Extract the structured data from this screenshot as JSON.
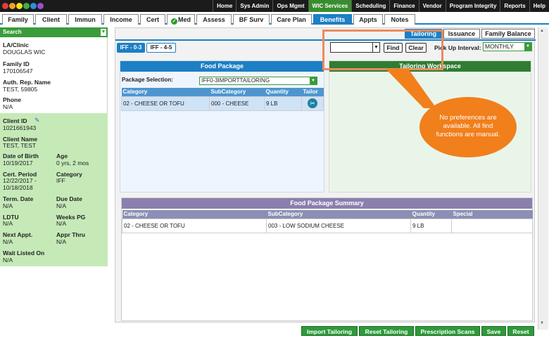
{
  "topnav": [
    "Home",
    "Sys Admin",
    "Ops Mgmt",
    "WIC Services",
    "Scheduling",
    "Finance",
    "Vendor",
    "Program Integrity",
    "Reports",
    "Help"
  ],
  "topnav_active": "WIC Services",
  "tabs": [
    "Family",
    "Client",
    "Immun",
    "Income",
    "Cert",
    "Med",
    "Assess",
    "BF Surv",
    "Care Plan",
    "Benefits",
    "Appts",
    "Notes"
  ],
  "tabs_active": "Benefits",
  "sidebar": {
    "search": "Search",
    "la_clinic_label": "LA/Clinic",
    "la_clinic": "DOUGLAS WIC",
    "family_id_label": "Family ID",
    "family_id": "170106547",
    "auth_rep_label": "Auth. Rep. Name",
    "auth_rep": "TEST, 59805",
    "phone_label": "Phone",
    "phone": "N/A",
    "client_id_label": "Client ID",
    "client_id": "1021661943",
    "client_name_label": "Client Name",
    "client_name": "TEST, TEST",
    "dob_label": "Date of Birth",
    "dob": "10/19/2017",
    "age_label": "Age",
    "age": "0 yrs, 2 mos",
    "cert_period_label": "Cert. Period",
    "cert_period_1": "12/22/2017 -",
    "cert_period_2": "10/18/2018",
    "category_label": "Category",
    "category": "IFF",
    "term_date_label": "Term. Date",
    "term_date": "N/A",
    "due_date_label": "Due Date",
    "due_date": "N/A",
    "ldtu_label": "LDTU",
    "ldtu": "N/A",
    "weeks_pg_label": "Weeks PG",
    "weeks_pg": "N/A",
    "next_appt_label": "Next Appt.",
    "next_appt": "N/A",
    "appr_thru_label": "Appr Thru",
    "appr_thru": "N/A",
    "wait_listed_label": "Wait Listed On",
    "wait_listed": "N/A"
  },
  "subtabs": {
    "tailoring": "Tailoring",
    "issuance": "Issuance",
    "family_balance": "Family Balance"
  },
  "age_tabs": {
    "a": "IFF - 0-3",
    "b": "IFF - 4-5"
  },
  "find_label": "Find",
  "clear_label": "Clear",
  "pickup_label": "Pick Up Interval:",
  "pickup_value": "MONTHLY",
  "food_package": {
    "title": "Food Package",
    "selection_label": "Package Selection:",
    "selection_value": "IFF0-3IMPORTTAILORING",
    "headers": [
      "Category",
      "SubCategory",
      "Quantity",
      "Tailor"
    ],
    "rows": [
      {
        "category": "02 - CHEESE OR TOFU",
        "subcategory": "000 - CHEESE",
        "quantity": "9 LB"
      }
    ]
  },
  "tailoring_workspace": "Tailoring Workspace",
  "callout": "No preferences are available. All find functions are manual.",
  "summary": {
    "title": "Food Package Summary",
    "headers": [
      "Category",
      "SubCategory",
      "Quantity",
      "Special"
    ],
    "rows": [
      {
        "category": "02 - CHEESE OR TOFU",
        "subcategory": "003 - LOW SODIUM CHEESE",
        "quantity": "9 LB",
        "special": ""
      }
    ]
  },
  "bottom_buttons": [
    "Import Tailoring",
    "Reset Tailoring",
    "Prescription Scans",
    "Save",
    "Reset"
  ],
  "colors": {
    "accent": "#1d7fc4",
    "green": "#2e9a3a",
    "callout": "#f17f1b"
  }
}
